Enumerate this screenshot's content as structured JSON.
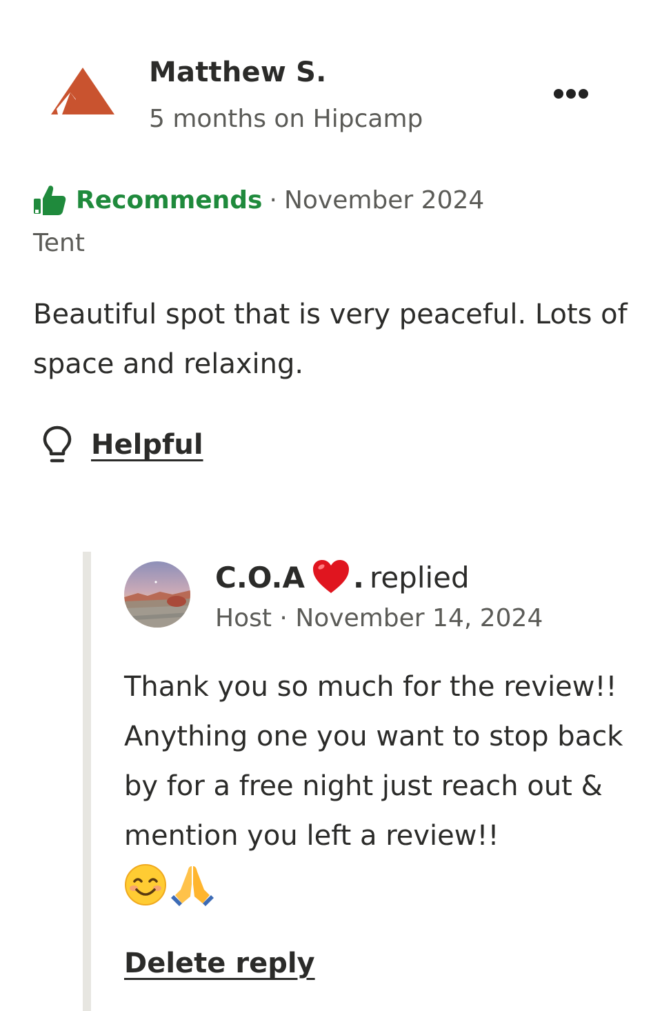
{
  "review": {
    "reviewer_name": "Matthew S.",
    "reviewer_tenure": "5 months on Hipcamp",
    "recommendation": "Recommends",
    "separator": "·",
    "date": "November 2024",
    "site_type": "Tent",
    "body": "Beautiful spot that is very peaceful. Lots of space and relaxing.",
    "helpful_label": "Helpful",
    "avatar_icon": "hipcamp-tent-logo-icon",
    "more_icon": "more-options-icon",
    "recommend_icon": "thumbs-up-icon",
    "helpful_icon": "lightbulb-icon"
  },
  "reply": {
    "host_name": "C.O.A",
    "host_name_suffix": ".",
    "replied_label": "replied",
    "heart_emoji": "❤️",
    "role": "Host",
    "separator": "·",
    "date": "November 14, 2024",
    "body": "Thank you so much for the review!! Anything one you want to stop back by for a free night just reach out & mention you left a review!!",
    "emojis": "😊🙏",
    "delete_label": "Delete reply"
  },
  "colors": {
    "recommend_green": "#1f8a3c",
    "logo_orange": "#c9532f",
    "text_primary": "#2b2b29",
    "text_secondary": "#5b5b57",
    "reply_rule": "#e7e6e1"
  }
}
